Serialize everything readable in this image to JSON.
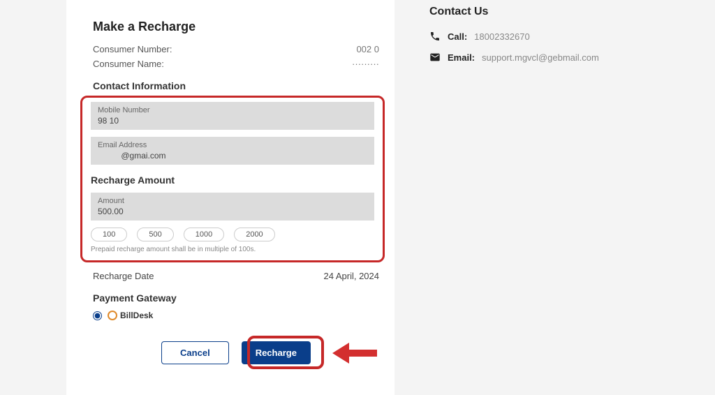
{
  "header": {
    "title": "Make a Recharge"
  },
  "consumer": {
    "number_label": "Consumer Number:",
    "number_value": "002   0",
    "name_label": "Consumer Name:",
    "name_value": "·········"
  },
  "contact_section": {
    "heading": "Contact Information",
    "mobile_label": "Mobile Number",
    "mobile_value": "98        10",
    "email_label": "Email Address",
    "email_value": "          @gmai.com"
  },
  "amount_section": {
    "heading": "Recharge Amount",
    "amount_label": "Amount",
    "amount_value": "500.00",
    "presets": [
      "100",
      "500",
      "1000",
      "2000"
    ],
    "hint": "Prepaid recharge amount shall be in multiple of 100s."
  },
  "date_row": {
    "label": "Recharge Date",
    "value": "24 April, 2024"
  },
  "gateway": {
    "heading": "Payment Gateway",
    "option": "BillDesk"
  },
  "buttons": {
    "cancel": "Cancel",
    "recharge": "Recharge"
  },
  "sidebar": {
    "heading": "Contact Us",
    "call_label": "Call:",
    "call_value": "18002332670",
    "email_label": "Email:",
    "email_value": "support.mgvcl@gebmail.com"
  }
}
